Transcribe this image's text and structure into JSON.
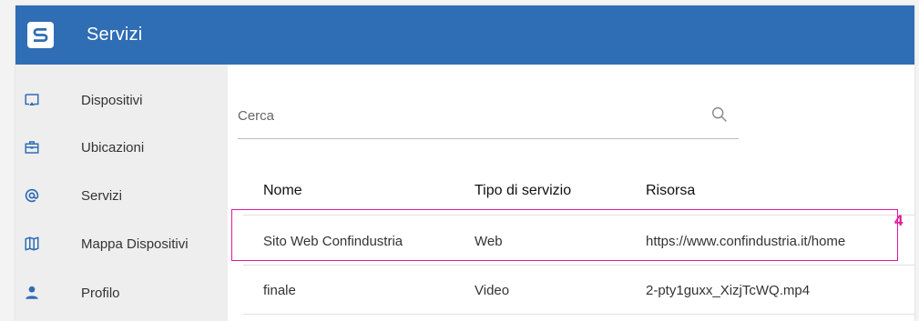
{
  "app": {
    "title": "Servizi",
    "logo_icon": "logo-s-icon",
    "brand_color": "#2f6db5"
  },
  "sidebar": {
    "items": [
      {
        "label": "Dispositivi",
        "icon": "cast-icon"
      },
      {
        "label": "Ubicazioni",
        "icon": "briefcase-icon"
      },
      {
        "label": "Servizi",
        "icon": "at-icon"
      },
      {
        "label": "Mappa Dispositivi",
        "icon": "map-icon"
      },
      {
        "label": "Profilo",
        "icon": "person-icon"
      }
    ]
  },
  "search": {
    "placeholder": "Cerca",
    "value": "",
    "icon": "search-icon"
  },
  "table": {
    "columns": [
      "Nome",
      "Tipo di servizio",
      "Risorsa"
    ],
    "rows": [
      {
        "nome": "Sito Web Confindustria",
        "tipo": "Web",
        "risorsa": "https://www.confindustria.it/home"
      },
      {
        "nome": "finale",
        "tipo": "Video",
        "risorsa": "2-pty1guxx_XizjTcWQ.mp4"
      }
    ]
  },
  "annotation": {
    "label": "4",
    "color": "#e0189b"
  }
}
